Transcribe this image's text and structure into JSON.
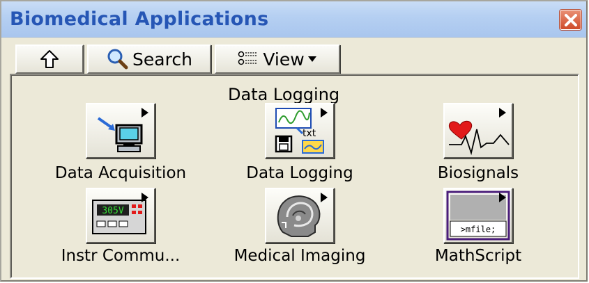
{
  "window": {
    "title": "Biomedical Applications",
    "close_icon": "close-x-icon"
  },
  "toolbar": {
    "up_icon": "up-arrow-icon",
    "search_label": "Search",
    "search_icon": "magnifier-icon",
    "view_label": "View",
    "view_icon": "view-list-icon",
    "view_dropdown_icon": "triangle-down-icon"
  },
  "palette": {
    "hover_label": "Data Logging",
    "items": [
      {
        "label": "Data Acquisition",
        "icon": "daq-computer-icon"
      },
      {
        "label": "Data Logging",
        "icon": "data-logging-icon"
      },
      {
        "label": "Biosignals",
        "icon": "heart-ecg-icon"
      },
      {
        "label": "Instr Commu...",
        "icon": "instrument-voltmeter-icon",
        "display_value": "305V"
      },
      {
        "label": "Medical Imaging",
        "icon": "head-scan-icon"
      },
      {
        "label": "MathScript",
        "icon": "mathscript-icon",
        "display_value": ">mfile;"
      }
    ]
  },
  "colors": {
    "title_text": "#2656b5",
    "title_bar": "#b6d0f2",
    "panel_bg": "#ece9d8",
    "close_button": "#d9583b"
  }
}
